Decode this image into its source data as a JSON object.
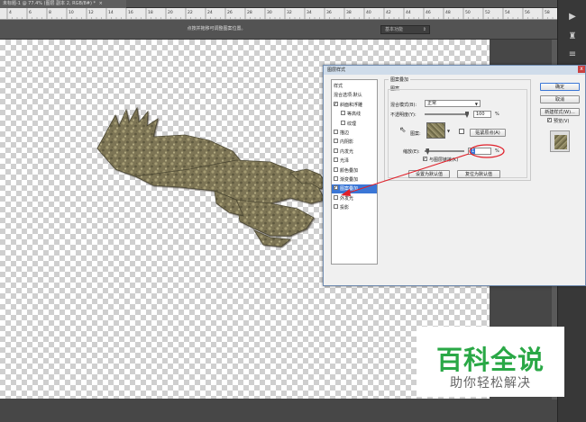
{
  "document_tab": {
    "title": "未标题-1 @ 77.4% (图层 副本 2, RGB/8#) *",
    "close": "×"
  },
  "ruler": {
    "labels": [
      "4",
      "6",
      "8",
      "10",
      "12",
      "14",
      "16",
      "18",
      "20",
      "22",
      "24",
      "26",
      "28",
      "30",
      "32",
      "34",
      "36",
      "38",
      "40",
      "42",
      "44",
      "46",
      "48",
      "50",
      "52",
      "54",
      "56",
      "58",
      "60"
    ]
  },
  "options_bar": {
    "hint": "点按并拖移可调整图案位置。",
    "workspace": "基本功能"
  },
  "dialog": {
    "title": "图层样式",
    "close": "x",
    "style_list": {
      "items": [
        {
          "label": "样式",
          "checkbox": false,
          "checked": false,
          "indent": false,
          "selected": false
        },
        {
          "label": "混合选项:默认",
          "checkbox": false,
          "checked": false,
          "indent": false,
          "selected": false
        },
        {
          "label": "斜面和浮雕",
          "checkbox": true,
          "checked": true,
          "indent": false,
          "selected": false
        },
        {
          "label": "等高线",
          "checkbox": true,
          "checked": false,
          "indent": true,
          "selected": false
        },
        {
          "label": "纹理",
          "checkbox": true,
          "checked": false,
          "indent": true,
          "selected": false
        },
        {
          "label": "描边",
          "checkbox": true,
          "checked": false,
          "indent": false,
          "selected": false
        },
        {
          "label": "内阴影",
          "checkbox": true,
          "checked": false,
          "indent": false,
          "selected": false
        },
        {
          "label": "内发光",
          "checkbox": true,
          "checked": false,
          "indent": false,
          "selected": false
        },
        {
          "label": "光泽",
          "checkbox": true,
          "checked": false,
          "indent": false,
          "selected": false
        },
        {
          "label": "颜色叠加",
          "checkbox": true,
          "checked": false,
          "indent": false,
          "selected": false
        },
        {
          "label": "渐变叠加",
          "checkbox": true,
          "checked": false,
          "indent": false,
          "selected": false
        },
        {
          "label": "图案叠加",
          "checkbox": true,
          "checked": true,
          "indent": false,
          "selected": true
        },
        {
          "label": "外发光",
          "checkbox": true,
          "checked": false,
          "indent": false,
          "selected": false
        },
        {
          "label": "投影",
          "checkbox": true,
          "checked": false,
          "indent": false,
          "selected": false
        }
      ]
    },
    "pattern_overlay": {
      "group_title": "图案叠加",
      "subgroup_title": "图案",
      "blend_mode_label": "混合模式(B):",
      "blend_mode_value": "正常",
      "opacity_label": "不透明度(Y):",
      "opacity_value": "100",
      "opacity_fraction": 1.0,
      "percent": "%",
      "pattern_label": "图案:",
      "snap_origin_button": "贴紧原点(A)",
      "scale_label": "缩放(E):",
      "scale_value": "1",
      "scale_fraction": 0.01,
      "link_label": "与图层链接(K)",
      "link_checked": true,
      "set_default_button": "设置为默认值",
      "reset_default_button": "复位为默认值"
    },
    "buttons": {
      "ok": "确定",
      "cancel": "取消",
      "new_style": "新建样式(W)...",
      "preview_label": "预览(V)",
      "preview_checked": true
    }
  },
  "watermark": {
    "title": "百科全说",
    "subtitle": "助你轻松解决"
  },
  "colors": {
    "accent": "#2aa846",
    "annotation": "#e0202a",
    "selection": "#3a76d6"
  }
}
